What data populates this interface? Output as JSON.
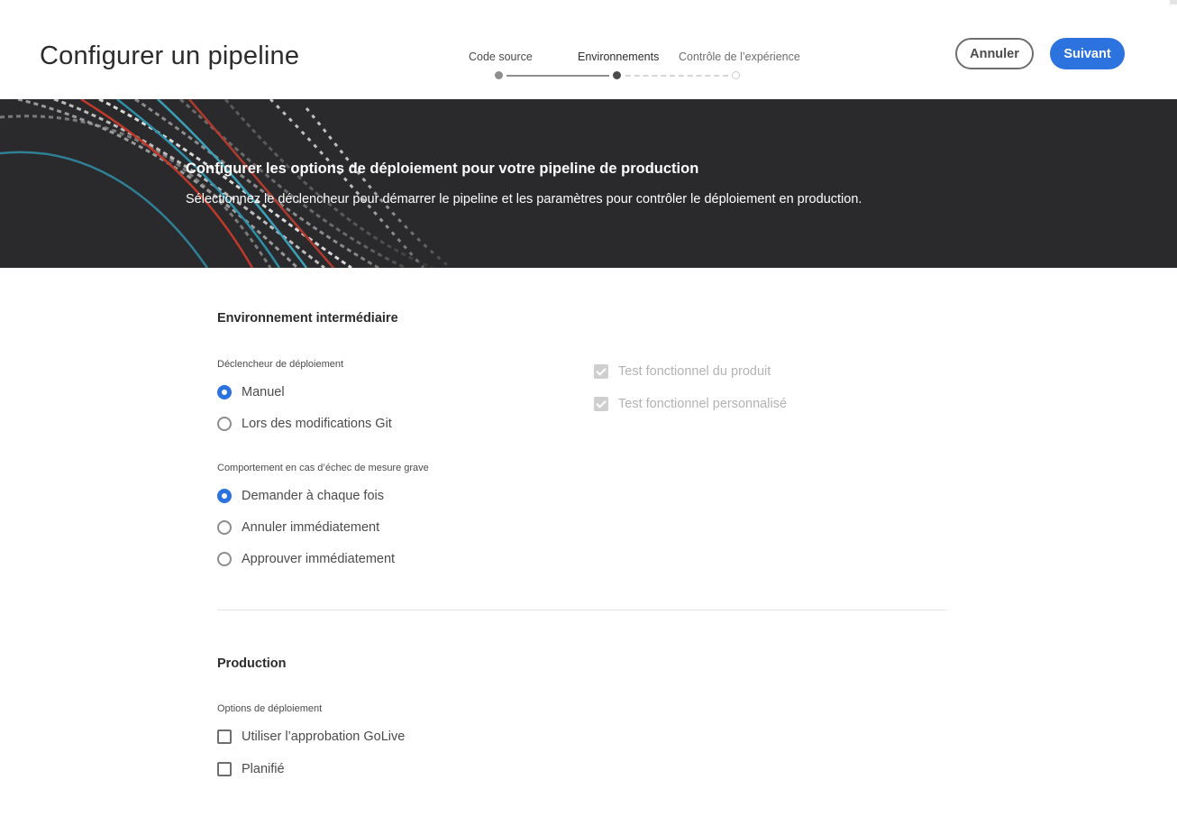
{
  "header": {
    "title": "Configurer un pipeline",
    "cancel_label": "Annuler",
    "next_label": "Suivant"
  },
  "stepper": {
    "steps": [
      {
        "label": "Code source",
        "state": "done"
      },
      {
        "label": "Environnements",
        "state": "current"
      },
      {
        "label": "Contrôle de l’expérience",
        "state": "upcoming"
      }
    ]
  },
  "banner": {
    "heading": "Configurer les options de déploiement pour votre pipeline de production",
    "subtitle": "Sélectionnez le déclencheur pour démarrer le pipeline et les paramètres pour contrôler le déploiement en production."
  },
  "staging": {
    "title": "Environnement intermédiaire",
    "trigger_label": "Déclencheur de déploiement",
    "trigger_options": [
      {
        "label": "Manuel",
        "selected": true
      },
      {
        "label": "Lors des modifications Git",
        "selected": false
      }
    ],
    "failure_label": "Comportement en cas d’échec de mesure grave",
    "failure_options": [
      {
        "label": "Demander à chaque fois",
        "selected": true
      },
      {
        "label": "Annuler immédiatement",
        "selected": false
      },
      {
        "label": "Approuver immédiatement",
        "selected": false
      }
    ],
    "tests": [
      {
        "label": "Test fonctionnel du produit",
        "checked": true,
        "disabled": true
      },
      {
        "label": "Test fonctionnel personnalisé",
        "checked": true,
        "disabled": true
      }
    ]
  },
  "production": {
    "title": "Production",
    "options_label": "Options de déploiement",
    "options": [
      {
        "label": "Utiliser l’approbation GoLive",
        "checked": false
      },
      {
        "label": "Planifié",
        "checked": false
      }
    ]
  },
  "colors": {
    "accent": "#2c73e0",
    "banner_bg": "#2a292c",
    "text": "#2c2c2c",
    "muted": "#b3b3b3"
  }
}
